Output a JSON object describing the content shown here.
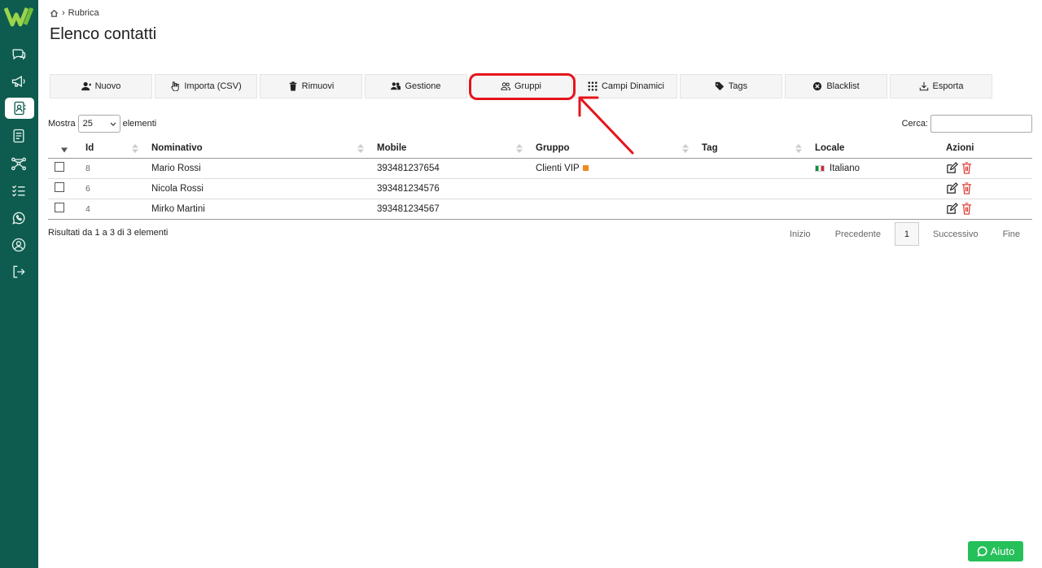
{
  "breadcrumb": {
    "current": "Rubrica"
  },
  "page": {
    "title": "Elenco contatti"
  },
  "toolbar": [
    {
      "id": "nuovo",
      "label": "Nuovo",
      "icon": "user-plus-icon"
    },
    {
      "id": "importa",
      "label": "Importa (CSV)",
      "icon": "hand-pointer-icon"
    },
    {
      "id": "rimuovi",
      "label": "Rimuovi",
      "icon": "trash-icon"
    },
    {
      "id": "gestione",
      "label": "Gestione",
      "icon": "users-icon"
    },
    {
      "id": "gruppi",
      "label": "Gruppi",
      "icon": "users-outline-icon"
    },
    {
      "id": "campi",
      "label": "Campi Dinamici",
      "icon": "grid-icon"
    },
    {
      "id": "tags",
      "label": "Tags",
      "icon": "tag-icon"
    },
    {
      "id": "blacklist",
      "label": "Blacklist",
      "icon": "x-circle-icon"
    },
    {
      "id": "esporta",
      "label": "Esporta",
      "icon": "download-icon"
    }
  ],
  "list": {
    "show_label": "Mostra",
    "show_value": "25",
    "elements_label": "elementi",
    "search_label": "Cerca:",
    "search_value": ""
  },
  "table": {
    "columns": [
      "Id",
      "Nominativo",
      "Mobile",
      "Gruppo",
      "Tag",
      "Locale",
      "Azioni"
    ],
    "rows": [
      {
        "id": "8",
        "name": "Mario Rossi",
        "mobile": "393481237654",
        "group": "Clienti VIP",
        "tag": "",
        "locale": "Italiano"
      },
      {
        "id": "6",
        "name": "Nicola Rossi",
        "mobile": "393481234576",
        "group": "",
        "tag": "",
        "locale": ""
      },
      {
        "id": "4",
        "name": "Mirko Martini",
        "mobile": "393481234567",
        "group": "",
        "tag": "",
        "locale": ""
      }
    ]
  },
  "footer": {
    "results": "Risultati da 1 a 3 di 3 elementi",
    "pager": {
      "first": "Inizio",
      "prev": "Precedente",
      "current": "1",
      "next": "Successivo",
      "last": "Fine"
    }
  },
  "help": {
    "label": "Aiuto"
  },
  "colors": {
    "sidebar": "#0d5c4f",
    "highlight": "#e5141b",
    "help": "#26c05a",
    "group_tag": "#ef8a1b",
    "delete": "#d9342b"
  }
}
